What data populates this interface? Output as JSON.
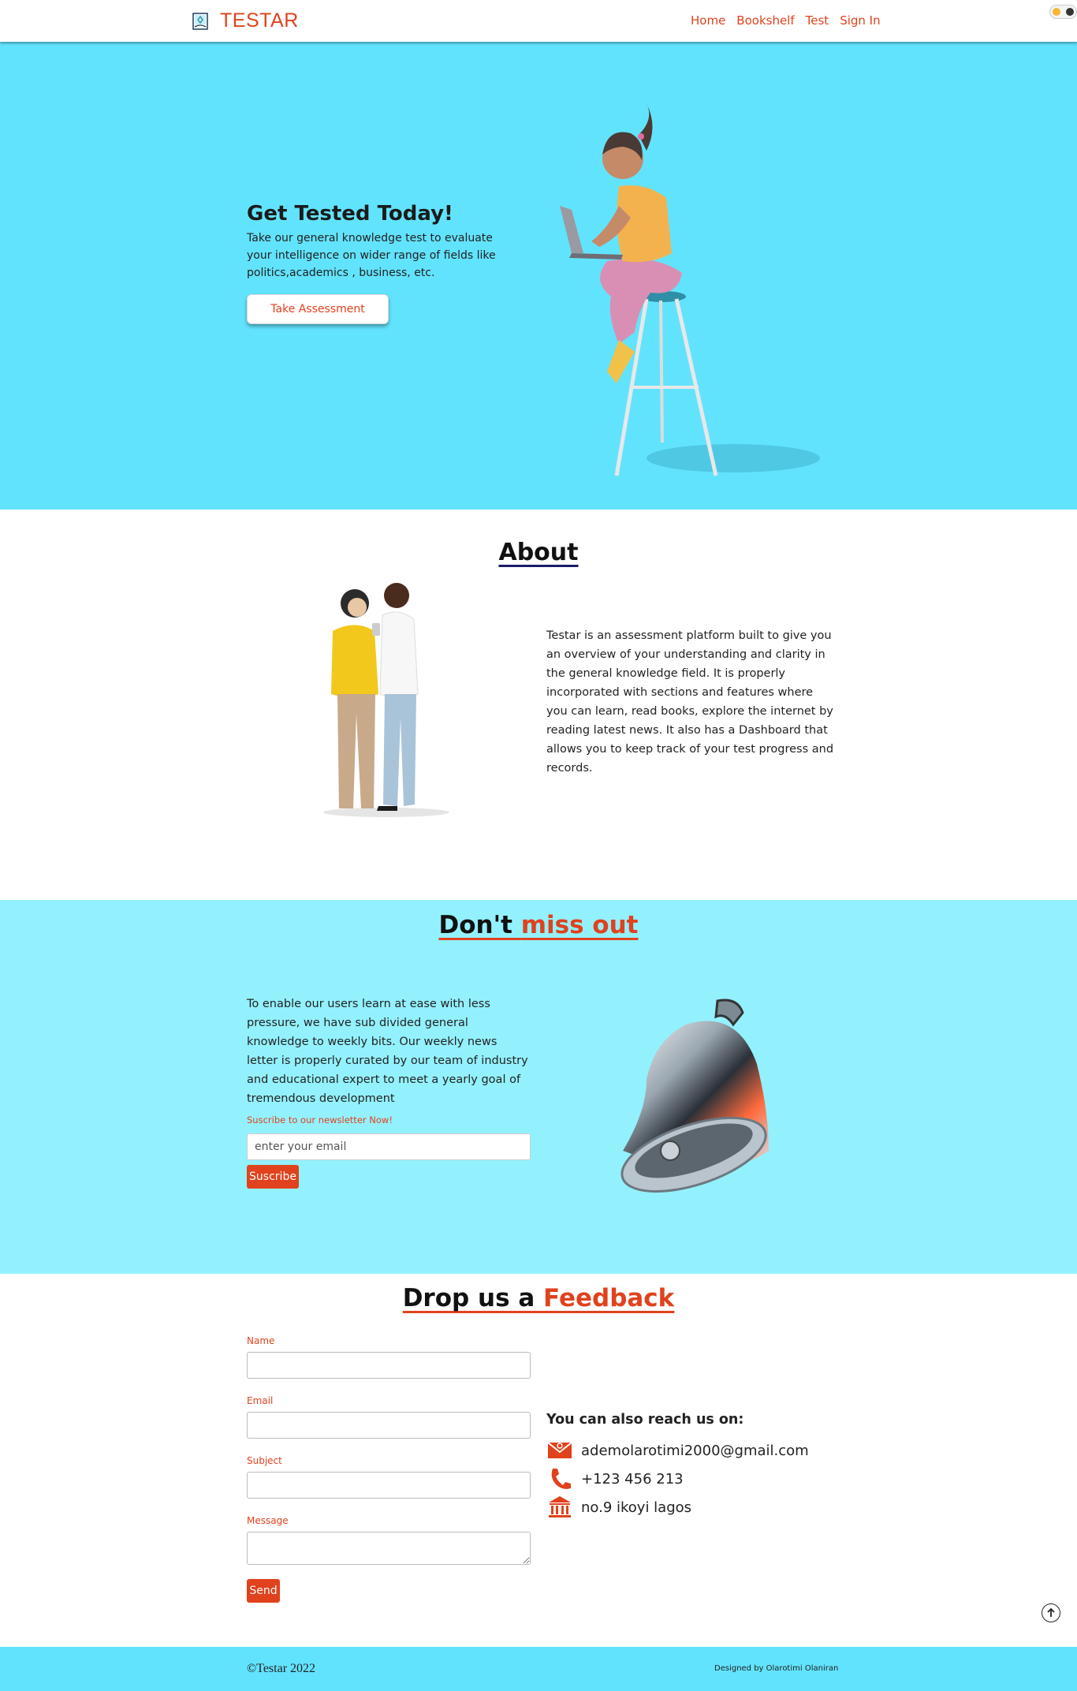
{
  "nav": {
    "brand": "TESTAR",
    "links": [
      "Home",
      "Bookshelf",
      "Test",
      "Sign In"
    ]
  },
  "hero": {
    "title": "Get Tested Today!",
    "text": "Take our general knowledge test to evaluate your intelligence on wider range of fields like politics,academics , business, etc.",
    "button": "Take Assessment"
  },
  "about": {
    "title": "About",
    "text": "Testar is an assessment platform built to give you an overview of your understanding and clarity in the general knowledge field. It is properly incorporated with sections and features where you can learn, read books, explore the internet by reading latest news. It also has a Dashboard that allows you to keep track of your test progress and records."
  },
  "newsletter": {
    "title_plain": "Don't ",
    "title_accent": "miss out",
    "text": "To enable our users learn at ease with less pressure, we have sub divided general knowledge to weekly bits. Our weekly news letter is properly curated by our team of industry and educational expert to meet a yearly goal of tremendous development",
    "label": "Suscribe to our newsletter Now!",
    "placeholder": "enter your email",
    "button": "Suscribe"
  },
  "feedback": {
    "title_plain": "Drop us a ",
    "title_accent": "Feedback",
    "name_label": "Name",
    "email_label": "Email",
    "subject_label": "Subject",
    "message_label": "Message",
    "button": "Send"
  },
  "contact": {
    "title": "You can also reach us on:",
    "email": "ademolarotimi2000@gmail.com",
    "phone": "+123 456 213",
    "address": "no.9 ikoyi lagos"
  },
  "footer": {
    "copyright": "©Testar 2022",
    "credit": "Designed by Olarotimi Olaniran"
  },
  "colors": {
    "accent": "#e0421d",
    "hero_bg": "#62e3fd",
    "newsletter_bg": "#93f1fd"
  },
  "icons": [
    "book-logo-icon",
    "theme-toggle-icon",
    "envelope-icon",
    "phone-icon",
    "bank-icon",
    "arrow-up-icon"
  ]
}
